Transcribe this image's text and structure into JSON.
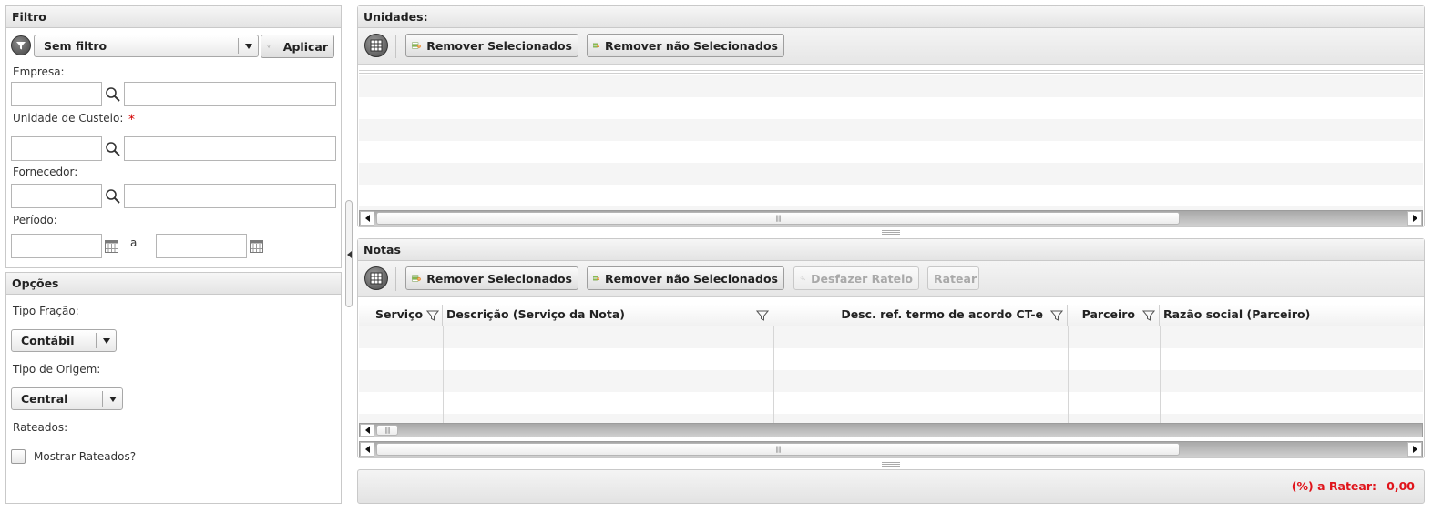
{
  "filtro": {
    "title": "Filtro",
    "filter_select": "Sem filtro",
    "apply_button": "Aplicar",
    "empresa_label": "Empresa:",
    "unidade_label": "Unidade de Custeio:",
    "required_mark": "*",
    "fornecedor_label": "Fornecedor:",
    "periodo_label": "Período:",
    "periodo_sep": "a"
  },
  "opcoes": {
    "title": "Opções",
    "tipo_fracao_label": "Tipo Fração:",
    "tipo_fracao_value": "Contábil",
    "tipo_origem_label": "Tipo de Origem:",
    "tipo_origem_value": "Central",
    "rateados_label": "Rateados:",
    "mostrar_rateados_label": "Mostrar Rateados?"
  },
  "unidades": {
    "title": "Unidades:",
    "remove_selected": "Remover Selecionados",
    "remove_unselected": "Remover não Selecionados"
  },
  "notas": {
    "title": "Notas",
    "remove_selected": "Remover Selecionados",
    "remove_unselected": "Remover não Selecionados",
    "undo_rateio": "Desfazer Rateio",
    "ratear": "Ratear",
    "columns": [
      "Serviço",
      "Descrição (Serviço da Nota)",
      "Desc. ref. termo de acordo CT-e",
      "Parceiro",
      "Razão social (Parceiro)"
    ]
  },
  "status": {
    "label": "(%) a Ratear:",
    "value": "0,00"
  },
  "colors": {
    "accent_red": "#e0141b",
    "header_bg": "#e4e4e4"
  }
}
